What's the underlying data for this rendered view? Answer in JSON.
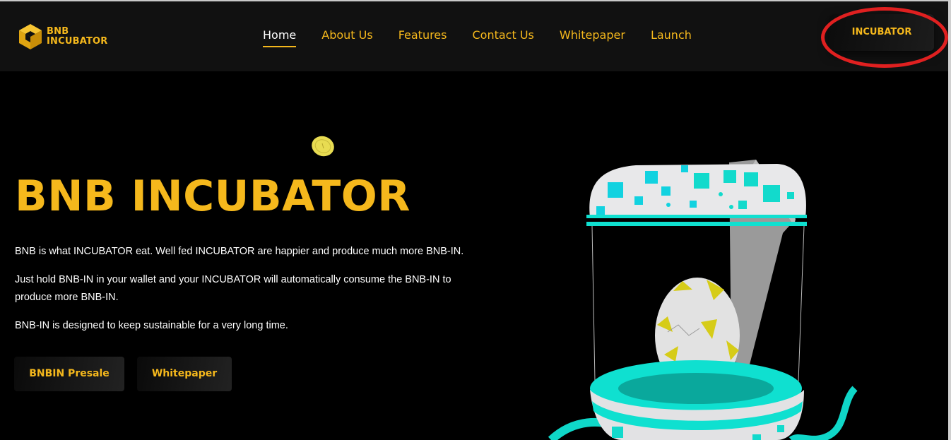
{
  "brand": {
    "line1": "BNB",
    "line2": "INCUBATOR",
    "logo_icon": "bnb-cube-icon",
    "color": "#f5b81c"
  },
  "nav": {
    "items": [
      {
        "label": "Home",
        "active": true
      },
      {
        "label": "About Us"
      },
      {
        "label": "Features"
      },
      {
        "label": "Contact Us"
      },
      {
        "label": "Whitepaper"
      },
      {
        "label": "Launch"
      }
    ]
  },
  "header": {
    "cta_label": "INCUBATOR",
    "highlight_color": "#e02020"
  },
  "hero": {
    "title": "BNB INCUBATOR",
    "paragraphs": [
      "BNB is what INCUBATOR eat. Well fed INCUBATOR are happier and produce much more BNB-IN.",
      "Just hold BNB-IN in your wallet and your INCUBATOR will automatically consume the BNB-IN to produce more BNB-IN.",
      "BNB-IN is designed to keep sustainable for a very long time."
    ],
    "buttons": {
      "presale": "BNBIN Presale",
      "whitepaper": "Whitepaper"
    }
  },
  "colors": {
    "accent": "#f5b81c",
    "background": "#000000",
    "header_bg": "#111111",
    "teal": "#00e0d0"
  }
}
